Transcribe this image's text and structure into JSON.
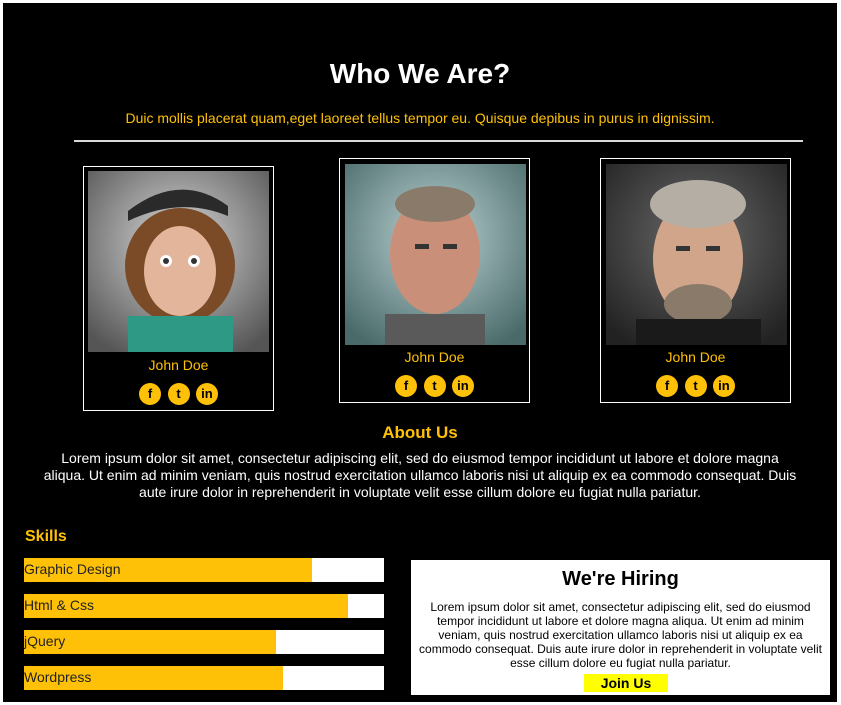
{
  "header": {
    "title": "Who We Are?",
    "subtitle": "Duic mollis placerat quam,eget laoreet tellus tempor eu. Quisque depibus in purus in dignissim."
  },
  "team": [
    {
      "name": "John Doe"
    },
    {
      "name": "John Doe"
    },
    {
      "name": "John Doe"
    }
  ],
  "social_icons": [
    "facebook-icon",
    "twitter-icon",
    "linkedin-icon"
  ],
  "about": {
    "title": "About Us",
    "text": "Lorem ipsum dolor sit amet, consectetur adipiscing elit, sed do eiusmod tempor incididunt ut labore et dolore magna aliqua. Ut enim ad minim veniam, quis nostrud exercitation ullamco laboris nisi ut aliquip ex ea commodo consequat. Duis aute irure dolor in reprehenderit in voluptate velit esse cillum dolore eu fugiat nulla pariatur."
  },
  "skills": {
    "title": "Skills",
    "items": [
      {
        "label": "Graphic Design",
        "level": 0.8
      },
      {
        "label": "Html & Css",
        "level": 0.9
      },
      {
        "label": "jQuery",
        "level": 0.7
      },
      {
        "label": "Wordpress",
        "level": 0.72
      }
    ]
  },
  "hiring": {
    "title": "We're Hiring",
    "text": "Lorem ipsum dolor sit amet, consectetur adipiscing elit, sed do eiusmod tempor incididunt ut labore et dolore magna aliqua. Ut enim ad minim veniam, quis nostrud exercitation ullamco laboris nisi ut aliquip ex ea commodo consequat. Duis aute irure dolor in reprehenderit in voluptate velit esse cillum dolore eu fugiat nulla pariatur.",
    "button": "Join Us"
  },
  "colors": {
    "background": "#000000",
    "accent": "#ffc107",
    "button": "#ffff00"
  }
}
